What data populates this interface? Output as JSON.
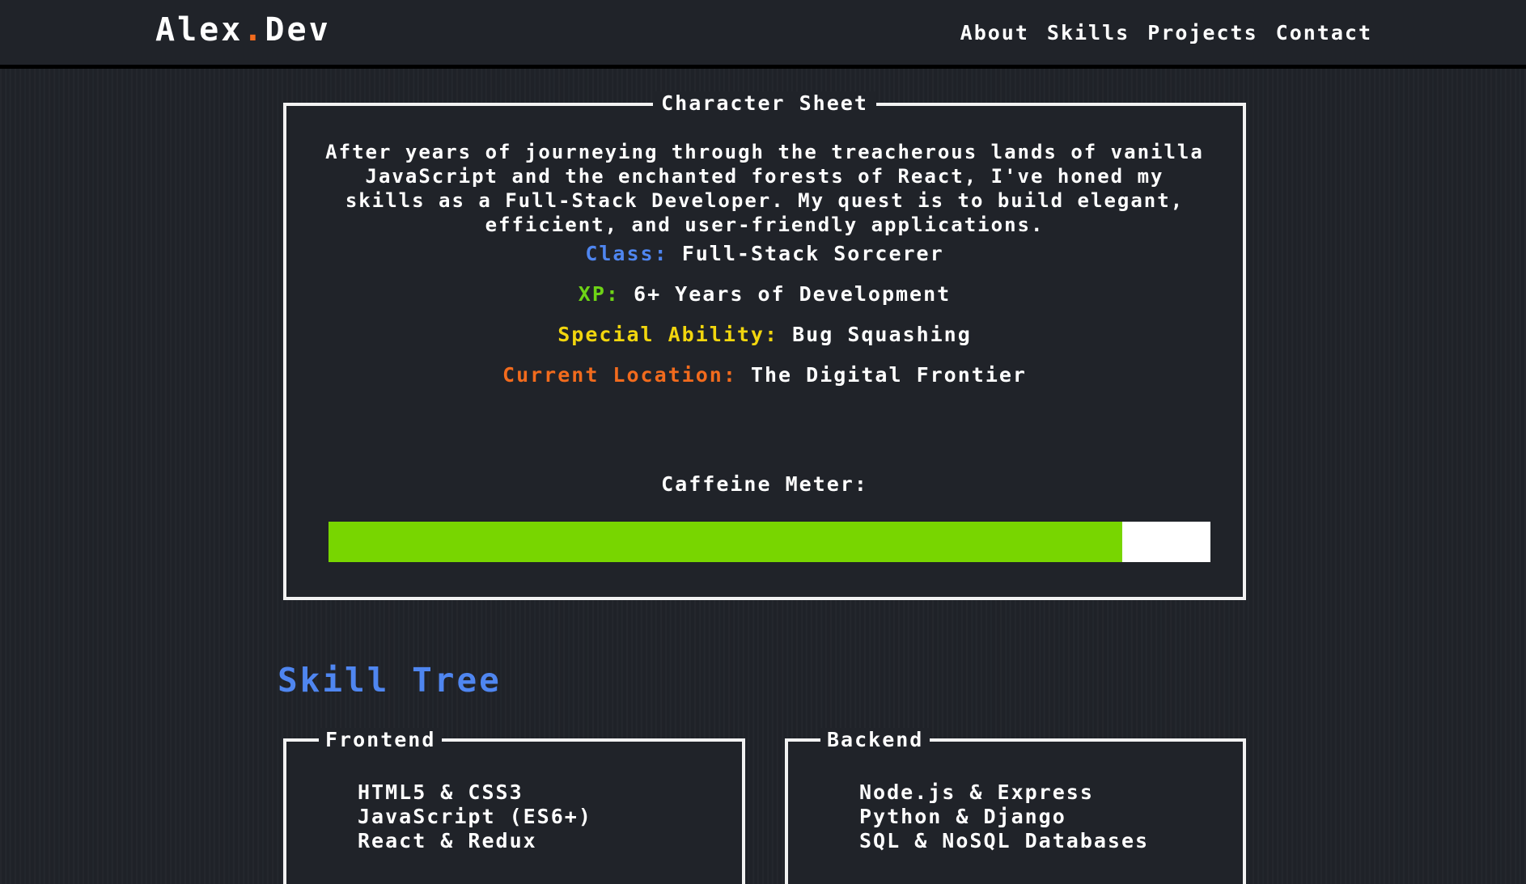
{
  "brand": {
    "name": "Alex",
    "dot": ".",
    "suffix": "Dev"
  },
  "nav": [
    "About",
    "Skills",
    "Projects",
    "Contact"
  ],
  "character_sheet": {
    "title": "Character Sheet",
    "bio": "After years of journeying through the treacherous lands of vanilla JavaScript and the enchanted forests of React, I've honed my skills as a Full-Stack Developer. My quest is to build elegant, efficient, and user-friendly applications.",
    "stats": [
      {
        "key": "Class:",
        "value": "Full-Stack Sorcerer",
        "color": "#4f86f0"
      },
      {
        "key": "XP:",
        "value": "6+ Years of Development",
        "color": "#6ed316"
      },
      {
        "key": "Special Ability:",
        "value": "Bug Squashing",
        "color": "#f2d60e"
      },
      {
        "key": "Current Location:",
        "value": "The Digital Frontier",
        "color": "#f26b1d"
      }
    ],
    "meter_label": "Caffeine Meter:",
    "caffeine_percent": 90
  },
  "skill_tree": {
    "title": "Skill Tree",
    "frontend": {
      "title": "Frontend",
      "items": [
        "HTML5 & CSS3",
        "JavaScript (ES6+)",
        "React & Redux"
      ]
    },
    "backend": {
      "title": "Backend",
      "items": [
        "Node.js & Express",
        "Python & Django",
        "SQL & NoSQL Databases"
      ]
    }
  },
  "colors": {
    "accent": "#f26b1d",
    "blue": "#4f86f0",
    "green": "#78d600",
    "background": "#1f2228"
  }
}
